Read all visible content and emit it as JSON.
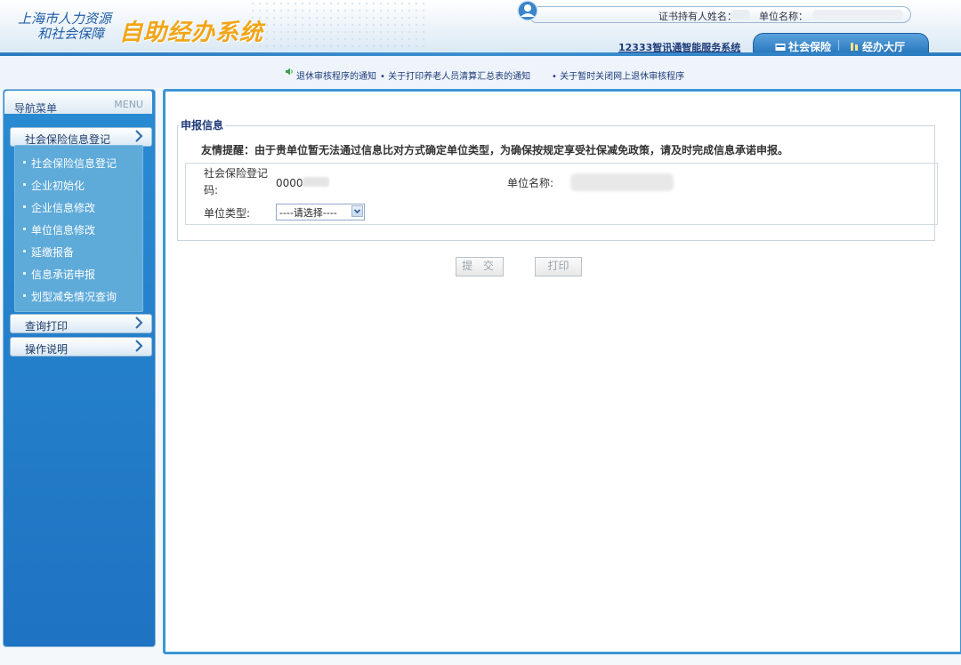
{
  "header": {
    "logo_line1": "上海市人力资源",
    "logo_line2": "和社会保障",
    "system_title": "自助经办系统",
    "cert_holder_label": "证书持有人姓名：",
    "unit_name_label": "单位名称：",
    "service_link": "12333智讯通智能服务系统",
    "tabs": [
      {
        "label": "社会保险"
      },
      {
        "label": "经办大厅"
      }
    ]
  },
  "notices": [
    "退休审核程序的通知",
    "• 关于打印养老人员清算汇总表的通知",
    "• 关于暂时关闭网上退休审核程序"
  ],
  "sidebar": {
    "title": "导航菜单",
    "title_en": "MENU",
    "sections": [
      {
        "label": "社会保险信息登记"
      },
      {
        "label": "查询打印"
      },
      {
        "label": "操作说明"
      }
    ],
    "items": [
      {
        "label": "社会保险信息登记"
      },
      {
        "label": "企业初始化"
      },
      {
        "label": "企业信息修改"
      },
      {
        "label": "单位信息修改"
      },
      {
        "label": "延缴报备"
      },
      {
        "label": "信息承诺申报"
      },
      {
        "label": "划型减免情况查询"
      }
    ]
  },
  "main": {
    "section_title": "申报信息",
    "reminder": "友情提醒：由于贵单位暂无法通过信息比对方式确定单位类型，为确保按规定享受社保减免政策，请及时完成信息承诺申报。",
    "fields": {
      "code_label": "社会保险登记码:",
      "code_value": "0000",
      "unit_name_label": "单位名称:",
      "unit_type_label": "单位类型:",
      "unit_type_value": "----请选择----"
    },
    "buttons": {
      "submit": "提 交",
      "print": "打印"
    }
  },
  "colors": {
    "accent": "#1f6fb6",
    "logo_orange": "#f2a516",
    "sidebar_blue": "#1e73c2"
  }
}
